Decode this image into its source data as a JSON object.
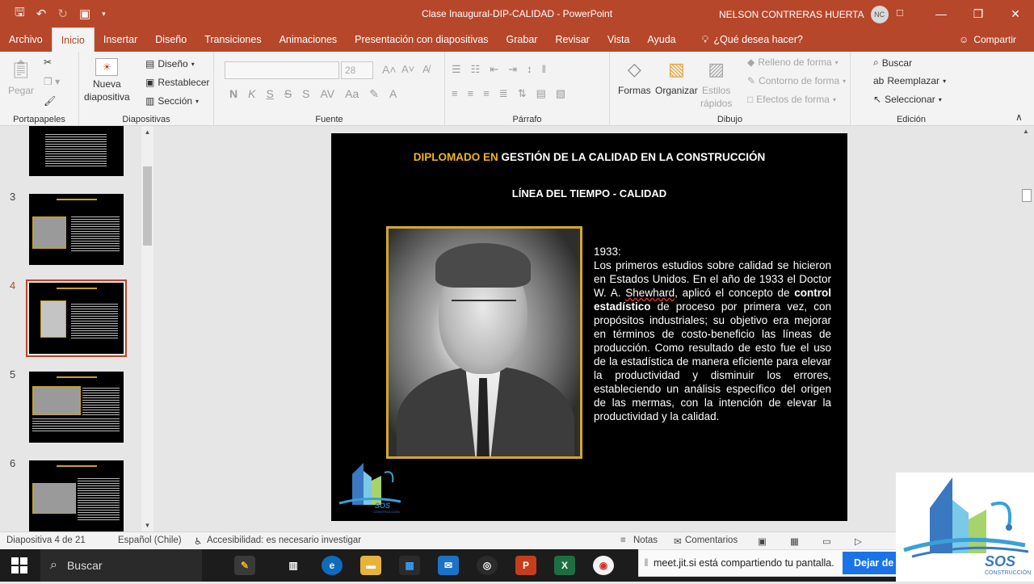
{
  "titlebar": {
    "document_title": "Clase Inaugural-DIP-CALIDAD  -  PowerPoint",
    "user_name": "NELSON CONTRERAS HUERTA",
    "user_initials": "NC"
  },
  "tabs": [
    "Archivo",
    "Inicio",
    "Insertar",
    "Diseño",
    "Transiciones",
    "Animaciones",
    "Presentación con diapositivas",
    "Grabar",
    "Revisar",
    "Vista",
    "Ayuda"
  ],
  "tell_me": "¿Qué desea hacer?",
  "share_label": "Compartir",
  "ribbon": {
    "portapapeles": {
      "label": "Portapapeles",
      "paste": "Pegar"
    },
    "diapositivas": {
      "label": "Diapositivas",
      "new_slide_1": "Nueva",
      "new_slide_2": "diapositiva",
      "layout": "Diseño",
      "reset": "Restablecer",
      "section": "Sección"
    },
    "fuente": {
      "label": "Fuente",
      "size": "28",
      "bold": "N",
      "italic": "K",
      "underline": "S",
      "strike": "S",
      "case": "Aa"
    },
    "parrafo": {
      "label": "Párrafo"
    },
    "dibujo": {
      "label": "Dibujo",
      "shapes": "Formas",
      "arrange": "Organizar",
      "styles_1": "Estilos",
      "styles_2": "rápidos",
      "fill": "Relleno de forma",
      "outline": "Contorno de forma",
      "effects": "Efectos de forma"
    },
    "edicion": {
      "label": "Edición",
      "find": "Buscar",
      "replace": "Reemplazar",
      "select": "Seleccionar"
    }
  },
  "thumbnails": [
    {
      "num": "3"
    },
    {
      "num": "4"
    },
    {
      "num": "5"
    },
    {
      "num": "6"
    }
  ],
  "slide": {
    "title_accent": "DIPLOMADO EN",
    "title_rest": " GESTIÓN DE LA CALIDAD EN LA CONSTRUCCIÓN",
    "subtitle": "LÍNEA DEL TIEMPO - CALIDAD",
    "year": "1933:",
    "text_1": "Los primeros estudios sobre calidad se hicieron en Estados Unidos. En el año de 1933 el Doctor W. A. ",
    "text_name": "Shewhard",
    "text_2": ", aplicó el concepto de ",
    "text_bold": "control estadístico",
    "text_3": " de proceso por primera vez,  con propósitos industriales; su objetivo era mejorar en términos de costo-beneficio las líneas de producción. Como resultado de esto fue el uso de la estadística de manera eficiente para elevar la productividad y disminuir los errores, estableciendo un análisis específico del origen de las mermas, con la intención de elevar la productividad y la calidad.",
    "logo_text": "SOS",
    "logo_sub": "CONSTRUCCIÓN"
  },
  "statusbar": {
    "slide_info": "Diapositiva 4 de 21",
    "language": "Español (Chile)",
    "accessibility": "Accesibilidad: es necesario investigar",
    "notes": "Notas",
    "comments": "Comentarios"
  },
  "taskbar": {
    "search": "Buscar"
  },
  "share_banner": {
    "text": "meet.jit.si está compartiendo tu pantalla.",
    "stop": "Dejar de c"
  },
  "overlay_logo": {
    "text": "SOS",
    "sub": "CONSTRUCCIÓN"
  },
  "colors": {
    "accent": "#b7472a",
    "title_accent": "#f0b323",
    "frame": "#d4a72c"
  }
}
